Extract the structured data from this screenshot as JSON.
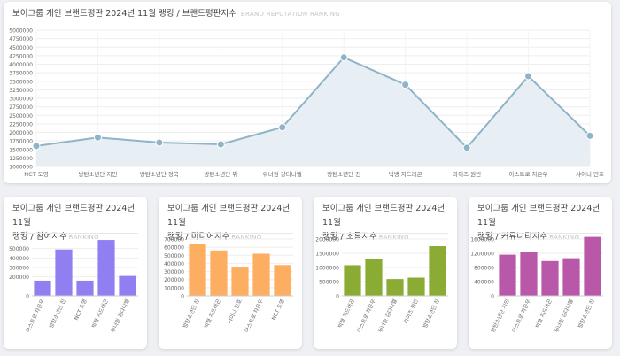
{
  "main": {
    "title": "보이그룹 개인 브랜드평판 2024년 11월 랭킹 / 브랜드평판지수",
    "subtitle": "BRAND REPUTATION RANKING"
  },
  "small": [
    {
      "title_line1": "보이그룹 개인 브랜드평판 2024년 11월",
      "title_line2": "랭킹 / 참여지수",
      "subtitle": "RANKING"
    },
    {
      "title_line1": "보이그룹 개인 브랜드평판 2024년 11월",
      "title_line2": "랭킹 / 미디어지수",
      "subtitle": "RANKING"
    },
    {
      "title_line1": "보이그룹 개인 브랜드평판 2024년 11월",
      "title_line2": "랭킹 / 소통지수",
      "subtitle": "RANKING"
    },
    {
      "title_line1": "보이그룹 개인 브랜드평판 2024년 11월",
      "title_line2": "랭킹 / 커뮤니티지수",
      "subtitle": "RANKING"
    }
  ],
  "colors": {
    "line": "#8fb3c8",
    "area": "#e4edf3",
    "bar1": "#8f7ff0",
    "bar2": "#fdae61",
    "bar3": "#8aab34",
    "bar4": "#b957a8"
  },
  "chart_data": [
    {
      "type": "area",
      "categories": [
        "NCT 도영",
        "방탄소년단 지민",
        "방탄소년단 정국",
        "방탄소년단 뷔",
        "워너원 강다니엘",
        "방탄소년단 진",
        "빅뱅 지드래곤",
        "라이즈 원빈",
        "아스트로 차은우",
        "샤이니 민호"
      ],
      "values": [
        1600000,
        1850000,
        1700000,
        1650000,
        2150000,
        4200000,
        3400000,
        1550000,
        3650000,
        1900000
      ],
      "ylim": [
        1000000,
        5000000
      ],
      "yticks": [
        "1000000",
        "1250000",
        "1500000",
        "1750000",
        "2000000",
        "2250000",
        "2500000",
        "2750000",
        "3000000",
        "3250000",
        "3500000",
        "3750000",
        "4000000",
        "4250000",
        "4500000",
        "4750000",
        "5000000"
      ],
      "ytick_values": [
        1000000,
        1250000,
        1500000,
        1750000,
        2000000,
        2250000,
        2500000,
        2750000,
        3000000,
        3250000,
        3500000,
        3750000,
        4000000,
        4250000,
        4500000,
        4750000,
        5000000
      ],
      "grid": true
    },
    {
      "type": "bar",
      "categories": [
        "아스트로 차은우",
        "방탄소년단 진",
        "NCT 도영",
        "빅뱅 지드래곤",
        "워너원 강다니엘"
      ],
      "values": [
        160000,
        490000,
        160000,
        590000,
        210000
      ],
      "ylim": [
        0,
        600000
      ],
      "yticks": [
        "0",
        "100000",
        "200000",
        "300000",
        "400000",
        "500000"
      ],
      "ytick_values": [
        0,
        200000,
        300000,
        400000,
        500000
      ],
      "grid": true
    },
    {
      "type": "bar",
      "categories": [
        "방탄소년단 진",
        "빅뱅 지드래곤",
        "샤이니 민호",
        "아스트로 차은우",
        "NCT 도영"
      ],
      "values": [
        640000,
        560000,
        350000,
        520000,
        380000
      ],
      "ylim": [
        0,
        700000
      ],
      "yticks": [
        "0",
        "100000",
        "200000",
        "300000",
        "400000",
        "500000",
        "600000",
        "700000"
      ],
      "ytick_values": [
        0,
        100000,
        200000,
        300000,
        400000,
        500000,
        600000,
        700000
      ],
      "grid": true
    },
    {
      "type": "bar",
      "categories": [
        "빅뱅 지드래곤",
        "아스트로 차은우",
        "워너원 강다니엘",
        "라이즈 원빈",
        "방탄소년단 진"
      ],
      "values": [
        1080000,
        1290000,
        590000,
        640000,
        1750000
      ],
      "ylim": [
        0,
        2000000
      ],
      "yticks": [
        "0",
        "500000",
        "1000000",
        "1500000",
        "2000000"
      ],
      "ytick_values": [
        0,
        500000,
        1000000,
        1500000,
        2000000
      ],
      "grid": true
    },
    {
      "type": "bar",
      "categories": [
        "방탄소년단 지민",
        "아스트로 차은우",
        "빅뱅 지드래곤",
        "워너원 강다니엘",
        "방탄소년단 진"
      ],
      "values": [
        1160000,
        1240000,
        980000,
        1060000,
        1660000
      ],
      "ylim": [
        0,
        1600000
      ],
      "yticks": [
        "0",
        "400000",
        "800000",
        "1200000",
        "1600000"
      ],
      "ytick_values": [
        0,
        400000,
        800000,
        1200000,
        1600000
      ],
      "grid": true
    }
  ]
}
